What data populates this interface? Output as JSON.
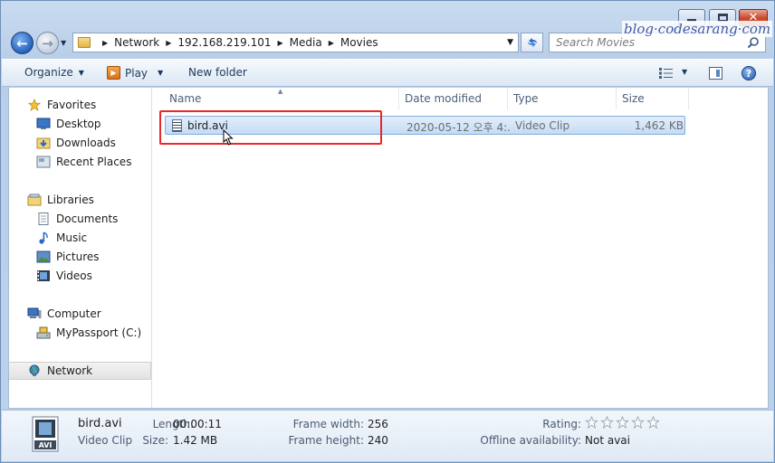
{
  "window": {
    "minimize_glyph": "—",
    "close_glyph": "✕"
  },
  "nav_buttons": {
    "back_glyph": "←",
    "forward_glyph": "→"
  },
  "address": {
    "breadcrumbs": [
      "Network",
      "192.168.219.101",
      "Media",
      "Movies"
    ],
    "separator": "▶"
  },
  "search": {
    "placeholder": "Search Movies"
  },
  "toolbar": {
    "organize_label": "Organize",
    "play_label": "Play",
    "new_folder_label": "New folder",
    "dropdown_glyph": "▼",
    "help_glyph": "?"
  },
  "sidebar": {
    "groups": [
      {
        "label": "Favorites",
        "icon": "star-icon",
        "items": [
          {
            "label": "Desktop",
            "icon": "desktop-icon"
          },
          {
            "label": "Downloads",
            "icon": "downloads-folder-icon"
          },
          {
            "label": "Recent Places",
            "icon": "recent-places-icon"
          }
        ]
      },
      {
        "label": "Libraries",
        "icon": "libraries-icon",
        "items": [
          {
            "label": "Documents",
            "icon": "documents-icon"
          },
          {
            "label": "Music",
            "icon": "music-icon"
          },
          {
            "label": "Pictures",
            "icon": "pictures-icon"
          },
          {
            "label": "Videos",
            "icon": "videos-icon"
          }
        ]
      },
      {
        "label": "Computer",
        "icon": "computer-icon",
        "items": [
          {
            "label": "MyPassport (C:)",
            "icon": "drive-icon"
          }
        ]
      },
      {
        "label": "Network",
        "icon": "network-icon",
        "items": [],
        "selected": true
      }
    ]
  },
  "columns": {
    "name": "Name",
    "date": "Date modified",
    "type": "Type",
    "size": "Size",
    "sort_glyph": "▲"
  },
  "files": [
    {
      "name": "bird.avi",
      "date": "2020-05-12 오후 4:...",
      "type": "Video Clip",
      "size": "1,462 KB"
    }
  ],
  "details": {
    "name": "bird.avi",
    "type": "Video Clip",
    "length_label": "Length:",
    "length": "00:00:11",
    "size_label": "Size:",
    "size": "1.42 MB",
    "frame_width_label": "Frame width:",
    "frame_width": "256",
    "frame_height_label": "Frame height:",
    "frame_height": "240",
    "rating_label": "Rating:",
    "rating": 0,
    "offline_label": "Offline availability:",
    "offline": "Not avai",
    "thumb_text": "AVI"
  },
  "watermark": "blog·codesarang·com",
  "colors": {
    "selection_outline": "#e8272a",
    "row_selected": "#c4dcf6",
    "accent": "#2a68c3"
  }
}
